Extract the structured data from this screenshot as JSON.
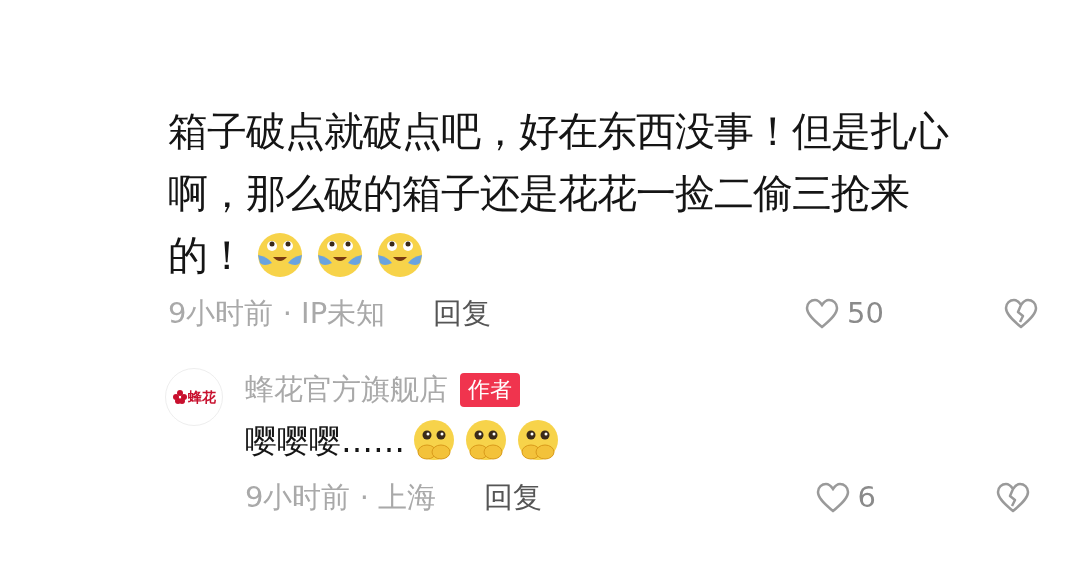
{
  "comment": {
    "lines": [
      "箱子破点就破点吧，好在东西没事！但是扎心",
      "啊，那么破的箱子还是花花一捡二偷三抢来",
      "的！"
    ],
    "emojis": [
      {
        "kind": "tears-of-joy"
      },
      {
        "kind": "tears-of-joy"
      },
      {
        "kind": "tears-of-joy"
      }
    ],
    "info": "9小时前 · IP未知",
    "reply_label": "回复",
    "likes": "50",
    "liked": false
  },
  "reply": {
    "avatar_text": "蜂花",
    "author": "蜂花官方旗舰店",
    "badge": "作者",
    "text": "嘤嘤嘤……",
    "emojis": [
      {
        "kind": "covering-mouth"
      },
      {
        "kind": "covering-mouth"
      },
      {
        "kind": "covering-mouth"
      }
    ],
    "info": "9小时前 · 上海",
    "reply_label": "回复",
    "likes": "6",
    "liked": false
  }
}
